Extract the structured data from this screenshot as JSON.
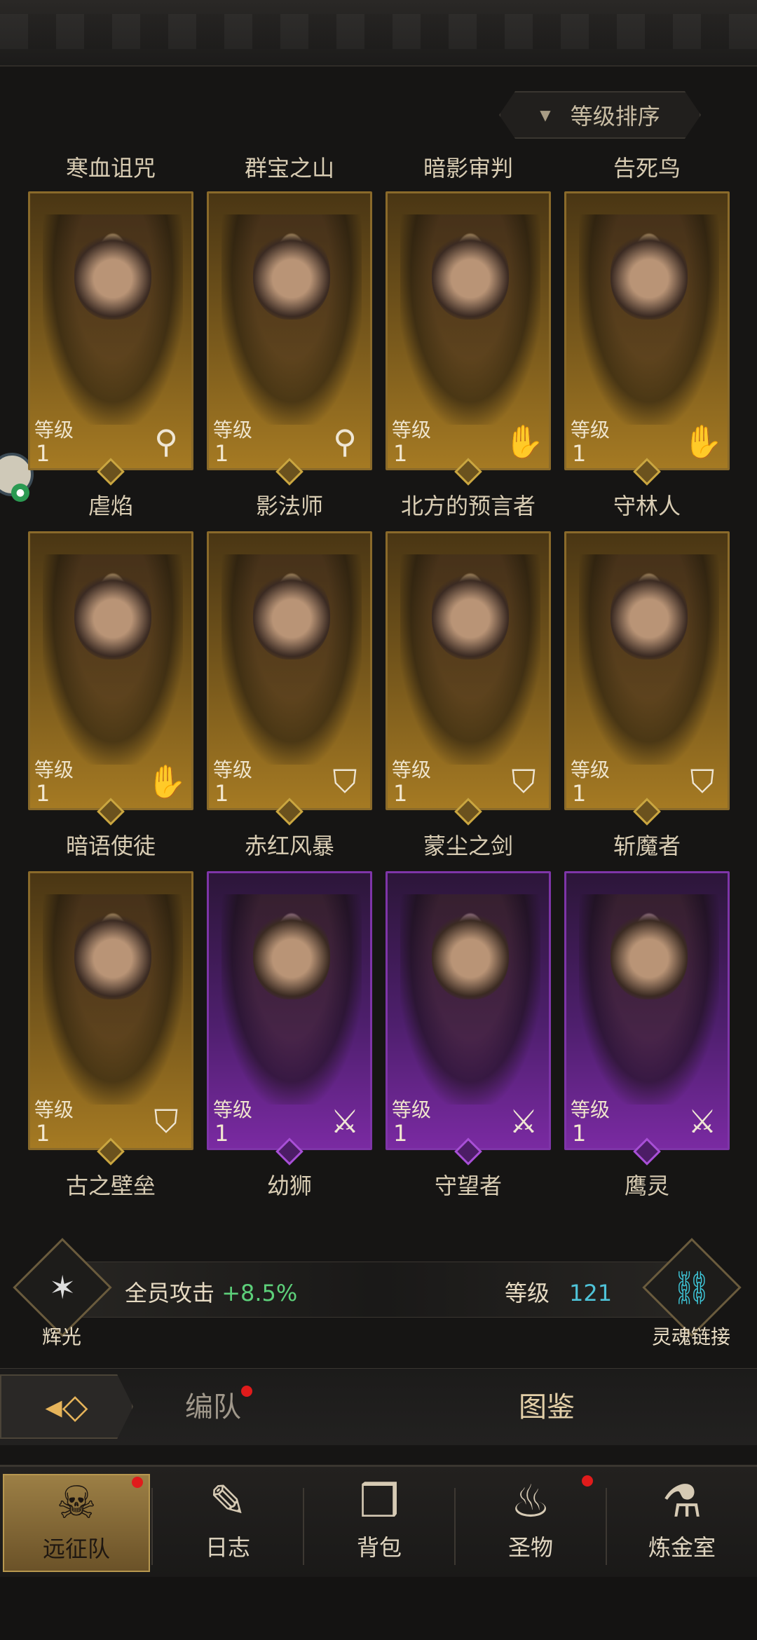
{
  "sort": {
    "label": "等级排序"
  },
  "level_label": "等级",
  "heroes": [
    {
      "top_name": "寒血诅咒",
      "level": "1",
      "class_icon": "staff-icon",
      "rarity": "gold",
      "bottom_name": "虐焰"
    },
    {
      "top_name": "群宝之山",
      "level": "1",
      "class_icon": "staff-icon",
      "rarity": "gold",
      "bottom_name": "影法师"
    },
    {
      "top_name": "暗影审判",
      "level": "1",
      "class_icon": "hand-icon",
      "rarity": "gold",
      "bottom_name": "北方的预言者"
    },
    {
      "top_name": "告死鸟",
      "level": "1",
      "class_icon": "hand-icon",
      "rarity": "gold",
      "bottom_name": "守林人"
    },
    {
      "level": "1",
      "class_icon": "hand-icon",
      "rarity": "gold",
      "bottom_name": "暗语使徒"
    },
    {
      "level": "1",
      "class_icon": "shield-icon",
      "rarity": "gold",
      "bottom_name": "赤红风暴"
    },
    {
      "level": "1",
      "class_icon": "shield-icon",
      "rarity": "gold",
      "bottom_name": "蒙尘之剑"
    },
    {
      "level": "1",
      "class_icon": "shield-icon",
      "rarity": "gold",
      "bottom_name": "斩魔者"
    },
    {
      "level": "1",
      "class_icon": "shield-icon",
      "rarity": "gold",
      "bottom_name": "古之壁垒"
    },
    {
      "level": "1",
      "class_icon": "sword-icon",
      "rarity": "purple",
      "bottom_name": "幼狮"
    },
    {
      "level": "1",
      "class_icon": "sword-icon",
      "rarity": "purple",
      "bottom_name": "守望者"
    },
    {
      "level": "1",
      "class_icon": "sword-icon",
      "rarity": "purple",
      "bottom_name": "鹰灵"
    }
  ],
  "bonus": {
    "left_label": "辉光",
    "text": "全员攻击",
    "value": "+8.5%",
    "level_label": "等级",
    "level_value": "121",
    "right_label": "灵魂链接"
  },
  "tabs": {
    "team": "编队",
    "codex": "图鉴"
  },
  "nav": [
    {
      "label": "远征队",
      "icon": "helmet-icon",
      "active": true
    },
    {
      "label": "日志",
      "icon": "scroll-icon",
      "active": false
    },
    {
      "label": "背包",
      "icon": "bag-icon",
      "active": false
    },
    {
      "label": "圣物",
      "icon": "relic-icon",
      "active": false
    },
    {
      "label": "炼金室",
      "icon": "alchemy-icon",
      "active": false
    }
  ],
  "colors": {
    "gold": "#a57a23",
    "purple": "#7a2aa2",
    "bonus_green": "#5dd07a",
    "level_cyan": "#4fc3d8",
    "badge_red": "#e01b1b"
  }
}
